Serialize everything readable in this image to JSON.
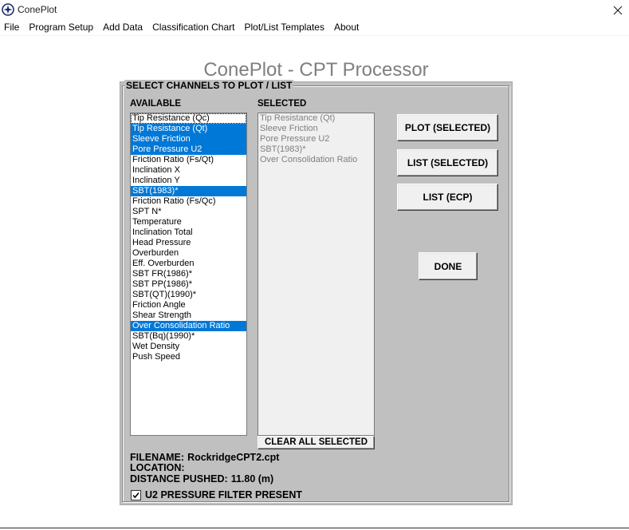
{
  "window": {
    "title": "ConePlot",
    "icons": {
      "app": "compass-icon",
      "close": "close-icon"
    }
  },
  "menu": {
    "items": [
      {
        "label": "File"
      },
      {
        "label": "Program Setup"
      },
      {
        "label": "Add Data"
      },
      {
        "label": "Classification Chart"
      },
      {
        "label": "Plot/List Templates"
      },
      {
        "label": "About"
      }
    ]
  },
  "heading": "ConePlot - CPT Processor",
  "panel": {
    "title": "SELECT CHANNELS TO PLOT / LIST",
    "available": {
      "label": "AVAILABLE",
      "items": [
        {
          "label": "Tip Resistance (Qc)",
          "highlighted": false,
          "focused": true
        },
        {
          "label": "Tip Resistance (Qt)",
          "highlighted": true
        },
        {
          "label": "Sleeve Friction",
          "highlighted": true
        },
        {
          "label": "Pore Pressure U2",
          "highlighted": true
        },
        {
          "label": "Friction Ratio (Fs/Qt)",
          "highlighted": false
        },
        {
          "label": "Inclination X",
          "highlighted": false
        },
        {
          "label": "Inclination Y",
          "highlighted": false
        },
        {
          "label": "SBT(1983)*",
          "highlighted": true
        },
        {
          "label": "Friction Ratio (Fs/Qc)",
          "highlighted": false
        },
        {
          "label": "SPT N*",
          "highlighted": false
        },
        {
          "label": "Temperature",
          "highlighted": false
        },
        {
          "label": "Inclination Total",
          "highlighted": false
        },
        {
          "label": "Head Pressure",
          "highlighted": false
        },
        {
          "label": "Overburden",
          "highlighted": false
        },
        {
          "label": "Eff. Overburden",
          "highlighted": false
        },
        {
          "label": "SBT FR(1986)*",
          "highlighted": false
        },
        {
          "label": "SBT PP(1986)*",
          "highlighted": false
        },
        {
          "label": "SBT(QT)(1990)*",
          "highlighted": false
        },
        {
          "label": "Friction Angle",
          "highlighted": false
        },
        {
          "label": "Shear Strength",
          "highlighted": false
        },
        {
          "label": "Over Consolidation Ratio",
          "highlighted": true
        },
        {
          "label": "SBT(Bq)(1990)*",
          "highlighted": false
        },
        {
          "label": "Wet Density",
          "highlighted": false
        },
        {
          "label": "Push Speed",
          "highlighted": false
        }
      ]
    },
    "selected_list": {
      "label": "SELECTED",
      "items": [
        {
          "label": "Tip Resistance (Qt)"
        },
        {
          "label": "Sleeve Friction"
        },
        {
          "label": "Pore Pressure U2"
        },
        {
          "label": "SBT(1983)*"
        },
        {
          "label": "Over Consolidation Ratio"
        }
      ]
    },
    "clear_button": "CLEAR ALL SELECTED",
    "buttons": {
      "plot_selected": "PLOT (SELECTED)",
      "list_selected": "LIST (SELECTED)",
      "list_ecp": "LIST (ECP)",
      "done": "DONE"
    },
    "info": {
      "filename_label": "FILENAME:",
      "filename": "RockridgeCPT2.cpt",
      "location_label": "LOCATION:",
      "distance_label": "DISTANCE PUSHED:",
      "distance": "11.80 (m)"
    },
    "filter_checkbox": {
      "label": "U2 PRESSURE FILTER PRESENT",
      "checked": true
    }
  },
  "colors": {
    "panel": "#c0c0c0",
    "highlight": "#0078d7",
    "heading": "#7f7f7f",
    "disabled_text": "#7f7f7f",
    "button_face": "#f0f0f0"
  }
}
